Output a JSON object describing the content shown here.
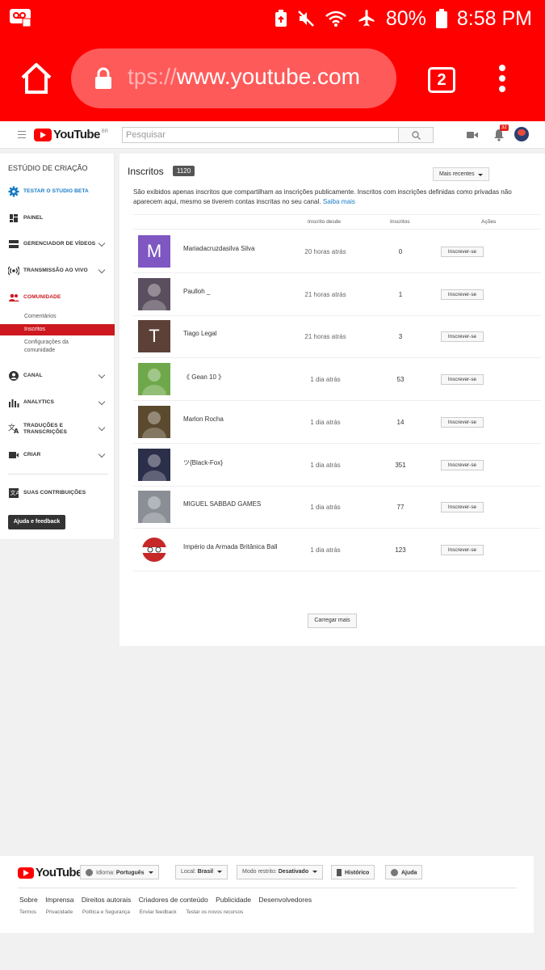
{
  "status": {
    "battery": "80%",
    "time": "8:58 PM",
    "tabs_count": "2",
    "url_fade": "tps://",
    "url_main": "www.youtube.com"
  },
  "header": {
    "logo_text": "YouTube",
    "region": "BR",
    "search_placeholder": "Pesquisar",
    "notifications": "32"
  },
  "sidebar": {
    "title": "ESTÚDIO DE CRIAÇÃO",
    "items": [
      {
        "label": "TESTAR O STUDIO BETA",
        "icon": "gear-icon"
      },
      {
        "label": "PAINEL",
        "icon": "dashboard-icon"
      },
      {
        "label": "GERENCIADOR DE VÍDEOS",
        "icon": "video-manager-icon"
      },
      {
        "label": "TRANSMISSÃO AO VIVO",
        "icon": "live-icon"
      },
      {
        "label": "COMUNIDADE",
        "icon": "community-icon"
      },
      {
        "label": "CANAL",
        "icon": "channel-icon"
      },
      {
        "label": "ANALYTICS",
        "icon": "analytics-icon"
      },
      {
        "label": "TRADUÇÕES E TRANSCRIÇÕES",
        "icon": "translate-icon"
      },
      {
        "label": "CRIAR",
        "icon": "create-icon"
      },
      {
        "label": "SUAS CONTRIBUIÇÕES",
        "icon": "contributions-icon"
      }
    ],
    "community_sub": [
      "Comentários",
      "Inscritos",
      "Configurações da comunidade"
    ],
    "help_label": "Ajuda e feedback"
  },
  "main": {
    "title": "Inscritos",
    "count": "1120",
    "sort_label": "Mais recentes",
    "description": "São exibidos apenas inscritos que compartilham as inscrições publicamente. Inscritos com inscrições definidas como privadas não aparecem aqui, mesmo se tiverem contas inscritas no seu canal.",
    "learn_more": "Saiba mais",
    "columns": {
      "since": "Inscrito desde",
      "subs": "Inscritos",
      "actions": "Ações"
    },
    "subscribe_label": "Inscrever-se",
    "rows": [
      {
        "name": "Mariadacruzdasilva Silva",
        "since": "20 horas atrás",
        "subs": "0",
        "letter": "M",
        "color": "#7e57c2"
      },
      {
        "name": "Paulloh _",
        "since": "21 horas atrás",
        "subs": "1",
        "letter": "",
        "color": "#5a4f5e"
      },
      {
        "name": "Tiago Legal",
        "since": "21 horas atrás",
        "subs": "3",
        "letter": "T",
        "color": "#5d4037"
      },
      {
        "name": "《 Gean 10 》",
        "since": "1 dia atrás",
        "subs": "53",
        "letter": "",
        "color": "#6fa84a"
      },
      {
        "name": "Marlon Rocha",
        "since": "1 dia atrás",
        "subs": "14",
        "letter": "",
        "color": "#5b4a2e"
      },
      {
        "name": "ツ{Black-Fox}",
        "since": "1 dia atrás",
        "subs": "351",
        "letter": "",
        "color": "#2b2f4a"
      },
      {
        "name": "MIGUEL SABBAD GAMES",
        "since": "1 dia atrás",
        "subs": "77",
        "letter": "",
        "color": "#8a8f95"
      },
      {
        "name": "Império da Armada Britânica Ball",
        "since": "1 dia atrás",
        "subs": "123",
        "letter": "",
        "color": "#ffffff"
      }
    ],
    "load_more": "Carregar mais"
  },
  "footer": {
    "logo_text": "YouTube",
    "language": {
      "label": "Idioma:",
      "value": "Português"
    },
    "location": {
      "label": "Local:",
      "value": "Brasil"
    },
    "restricted": {
      "label": "Modo restrito:",
      "value": "Desativado"
    },
    "history": "Histórico",
    "help": "Ajuda",
    "links": [
      "Sobre",
      "Imprensa",
      "Direitos autorais",
      "Criadores de conteúdo",
      "Publicidade",
      "Desenvolvedores"
    ],
    "small_links": [
      "Termos",
      "Privacidade",
      "Política e Segurança",
      "Enviar feedback",
      "Testar os novos recursos"
    ]
  }
}
